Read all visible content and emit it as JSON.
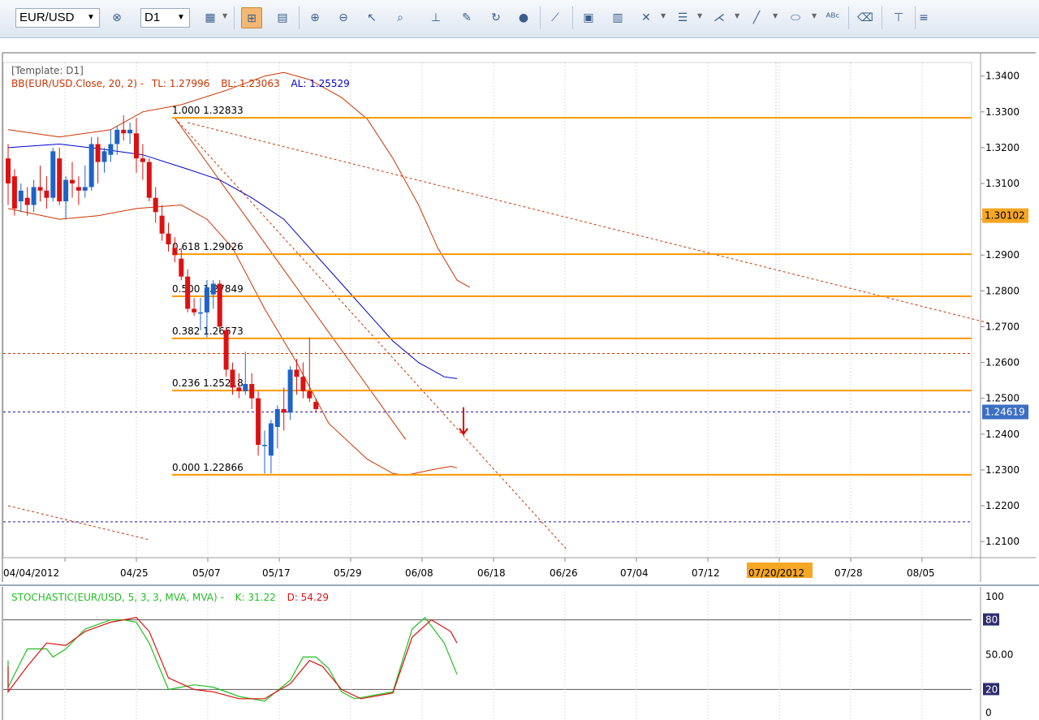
{
  "toolbar": {
    "symbol": "EUR/USD",
    "timeframe": "D1",
    "icons": [
      "chart-type-icon",
      "crosshair-icon",
      "template-icon",
      "zoom-in-icon",
      "zoom-out-icon",
      "cursor-icon",
      "magnifier-icon",
      "period-separator-icon",
      "template-icon",
      "refresh-icon",
      "globe-icon",
      "ruler-icon",
      "image-icon",
      "picture-icon",
      "tools-icon",
      "lines-icon",
      "fan-icon",
      "pencil-icon",
      "ellipse-icon",
      "text-icon",
      "eraser-icon",
      "hierarchy-icon",
      "menu-icon"
    ]
  },
  "chart_data": [
    {
      "type": "candlestick",
      "annotations": {
        "template": "[Template: D1]",
        "bb_label": "BB(EUR/USD.Close, 20, 2) -",
        "bb_tl": "TL: 1.27996",
        "bb_bl": "BL: 1.23063",
        "bb_al": "AL: 1.25529",
        "bb_color": "#cc3300",
        "al_color": "#0000cc"
      },
      "y_axis": {
        "ylim": [
          1.2055,
          1.3465
        ],
        "ticks": [
          "1.3400",
          "1.3300",
          "1.3200",
          "1.3100",
          "1.3000",
          "1.2900",
          "1.2800",
          "1.2700",
          "1.2600",
          "1.2500",
          "1.2400",
          "1.2300",
          "1.2200",
          "1.2100"
        ],
        "tick_values": [
          1.34,
          1.33,
          1.32,
          1.31,
          1.3,
          1.29,
          1.28,
          1.27,
          1.26,
          1.25,
          1.24,
          1.23,
          1.22,
          1.21
        ]
      },
      "x_axis": {
        "labels": [
          "04/04/2012",
          "04/25",
          "05/07",
          "05/17",
          "05/29",
          "06/08",
          "06/18",
          "06/26",
          "07/04",
          "07/12",
          "07/20/2012",
          "07/28",
          "08/05"
        ],
        "highlight_label": "07/20/2012",
        "highlight_color": "#f5a623"
      },
      "price_labels": [
        {
          "text": "1.30102",
          "value": 1.30102,
          "bg": "#f5a623"
        },
        {
          "text": "1.24619",
          "value": 1.24619,
          "bg": "#3c6fc4"
        }
      ],
      "fibonacci": [
        {
          "label": "1.000 1.32833",
          "value": 1.32833
        },
        {
          "label": "0.618 1.29026",
          "value": 1.29026
        },
        {
          "label": "0.500 1.27849",
          "value": 1.27849
        },
        {
          "label": "0.382 1.26673",
          "value": 1.26673
        },
        {
          "label": "0.236 1.25218",
          "value": 1.25218
        },
        {
          "label": "0.000 1.22866",
          "value": 1.22866
        }
      ],
      "horizontal_lines": [
        {
          "value": 1.2625,
          "color": "#cc3300",
          "style": "dashed"
        },
        {
          "value": 1.24619,
          "color": "#1a1aaa",
          "style": "dashed"
        },
        {
          "value": 1.2155,
          "color": "#1a1aaa",
          "style": "dashed"
        }
      ],
      "candles": [
        [
          1.317,
          1.321,
          1.304,
          1.31
        ],
        [
          1.312,
          1.314,
          1.301,
          1.303
        ],
        [
          1.305,
          1.31,
          1.302,
          1.308
        ],
        [
          1.306,
          1.309,
          1.301,
          1.304
        ],
        [
          1.304,
          1.311,
          1.302,
          1.309
        ],
        [
          1.309,
          1.315,
          1.305,
          1.308
        ],
        [
          1.308,
          1.312,
          1.303,
          1.306
        ],
        [
          1.306,
          1.32,
          1.305,
          1.319
        ],
        [
          1.317,
          1.32,
          1.304,
          1.305
        ],
        [
          1.305,
          1.312,
          1.3,
          1.311
        ],
        [
          1.311,
          1.316,
          1.306,
          1.31
        ],
        [
          1.309,
          1.312,
          1.304,
          1.308
        ],
        [
          1.308,
          1.315,
          1.306,
          1.309
        ],
        [
          1.309,
          1.323,
          1.308,
          1.321
        ],
        [
          1.321,
          1.323,
          1.31,
          1.316
        ],
        [
          1.316,
          1.32,
          1.313,
          1.319
        ],
        [
          1.318,
          1.325,
          1.316,
          1.321
        ],
        [
          1.321,
          1.326,
          1.318,
          1.325
        ],
        [
          1.325,
          1.329,
          1.322,
          1.324
        ],
        [
          1.324,
          1.327,
          1.321,
          1.325
        ],
        [
          1.324,
          1.3283,
          1.313,
          1.317
        ],
        [
          1.317,
          1.321,
          1.311,
          1.316
        ],
        [
          1.316,
          1.317,
          1.305,
          1.306
        ],
        [
          1.306,
          1.309,
          1.299,
          1.302
        ],
        [
          1.301,
          1.304,
          1.294,
          1.296
        ],
        [
          1.296,
          1.299,
          1.291,
          1.293
        ],
        [
          1.292,
          1.295,
          1.288,
          1.29
        ],
        [
          1.289,
          1.292,
          1.283,
          1.284
        ],
        [
          1.284,
          1.286,
          1.274,
          1.275
        ],
        [
          1.275,
          1.278,
          1.273,
          1.274
        ],
        [
          1.274,
          1.278,
          1.269,
          1.274
        ],
        [
          1.274,
          1.283,
          1.267,
          1.281
        ],
        [
          1.279,
          1.283,
          1.275,
          1.282
        ],
        [
          1.282,
          1.283,
          1.269,
          1.27
        ],
        [
          1.269,
          1.27,
          1.256,
          1.258
        ],
        [
          1.258,
          1.26,
          1.251,
          1.253
        ],
        [
          1.253,
          1.257,
          1.25,
          1.252
        ],
        [
          1.252,
          1.263,
          1.251,
          1.254
        ],
        [
          1.254,
          1.257,
          1.247,
          1.25
        ],
        [
          1.25,
          1.252,
          1.234,
          1.237
        ],
        [
          1.237,
          1.241,
          1.229,
          1.237
        ],
        [
          1.234,
          1.244,
          1.229,
          1.243
        ],
        [
          1.242,
          1.248,
          1.236,
          1.247
        ],
        [
          1.247,
          1.253,
          1.241,
          1.246
        ],
        [
          1.246,
          1.259,
          1.244,
          1.258
        ],
        [
          1.258,
          1.261,
          1.251,
          1.256
        ],
        [
          1.256,
          1.26,
          1.25,
          1.252
        ],
        [
          1.252,
          1.267,
          1.249,
          1.25
        ],
        [
          1.249,
          1.25,
          1.246,
          1.247
        ]
      ],
      "bollinger": {
        "upper": [
          [
            0,
            1.325
          ],
          [
            8,
            1.323
          ],
          [
            16,
            1.325
          ],
          [
            21,
            1.33
          ],
          [
            27,
            1.332
          ],
          [
            34,
            1.336
          ],
          [
            40,
            1.34
          ],
          [
            43,
            1.341
          ],
          [
            47,
            1.339
          ],
          [
            52,
            1.334
          ],
          [
            56,
            1.328
          ],
          [
            60,
            1.317
          ],
          [
            64,
            1.304
          ],
          [
            67,
            1.292
          ],
          [
            70,
            1.283
          ],
          [
            72,
            1.281
          ]
        ],
        "middle": [
          [
            0,
            1.32
          ],
          [
            8,
            1.321
          ],
          [
            15,
            1.3195
          ],
          [
            21,
            1.318
          ],
          [
            28,
            1.314
          ],
          [
            33,
            1.311
          ],
          [
            38,
            1.306
          ],
          [
            43,
            1.3
          ],
          [
            47,
            1.292
          ],
          [
            52,
            1.282
          ],
          [
            56,
            1.274
          ],
          [
            60,
            1.266
          ],
          [
            64,
            1.26
          ],
          [
            68,
            1.256
          ],
          [
            70,
            1.2555
          ]
        ],
        "lower": [
          [
            0,
            1.303
          ],
          [
            8,
            1.3
          ],
          [
            14,
            1.301
          ],
          [
            20,
            1.303
          ],
          [
            27,
            1.304
          ],
          [
            31,
            1.3
          ],
          [
            35,
            1.292
          ],
          [
            40,
            1.275
          ],
          [
            45,
            1.26
          ],
          [
            50,
            1.243
          ],
          [
            56,
            1.233
          ],
          [
            60,
            1.229
          ],
          [
            62,
            1.2285
          ],
          [
            66,
            1.23
          ],
          [
            69,
            1.231
          ],
          [
            70,
            1.2306
          ]
        ]
      },
      "trendlines": [
        {
          "points": [
            [
              26,
              1.3283
            ],
            [
              87,
              1.208
            ]
          ],
          "style": "dashed"
        },
        {
          "points": [
            [
              26,
              1.3283
            ],
            [
              62,
              1.2385
            ]
          ],
          "style": "solid"
        },
        {
          "points": [
            [
              28,
              1.327
            ],
            [
              153,
              1.271
            ]
          ],
          "style": "dashed"
        },
        {
          "points": [
            [
              0,
              1.22
            ],
            [
              22,
              1.2105
            ]
          ],
          "style": "dashed"
        }
      ],
      "arrow": {
        "index": 70,
        "from": 1.2475,
        "to": 1.24,
        "color": "#dd0000"
      }
    },
    {
      "type": "line",
      "label": {
        "name": "STOCHASTIC(EUR/USD, 5, 3, 3, MVA, MVA) -",
        "k": "K: 31.22",
        "d": "D: 54.29",
        "k_color": "#22c022",
        "d_color": "#dd1111"
      },
      "ylim": [
        0,
        100
      ],
      "ticks": [
        "100",
        "80",
        "50.00",
        "20",
        "0"
      ],
      "tick_values": [
        100,
        80,
        50,
        20,
        0
      ],
      "series": [
        {
          "color": "#22c022",
          "values": [
            [
              0,
              45
            ],
            [
              3,
              25
            ],
            [
              6,
              22
            ],
            [
              9,
              55
            ],
            [
              12,
              55
            ],
            [
              13,
              48
            ],
            [
              15,
              55
            ],
            [
              18,
              72
            ],
            [
              22,
              80
            ],
            [
              24,
              80
            ],
            [
              26,
              78
            ],
            [
              28,
              60
            ],
            [
              31,
              20
            ],
            [
              35,
              24
            ],
            [
              38,
              22
            ],
            [
              42,
              14
            ],
            [
              46,
              10
            ],
            [
              50,
              28
            ],
            [
              52,
              48
            ],
            [
              54,
              48
            ],
            [
              56,
              38
            ],
            [
              58,
              18
            ],
            [
              60,
              12
            ],
            [
              63,
              15
            ],
            [
              66,
              18
            ],
            [
              69,
              72
            ],
            [
              71,
              82
            ],
            [
              74,
              60
            ],
            [
              76,
              33
            ]
          ]
        },
        {
          "color": "#dd1111",
          "values": [
            [
              0,
              40
            ],
            [
              3,
              22
            ],
            [
              6,
              18
            ],
            [
              9,
              40
            ],
            [
              12,
              60
            ],
            [
              15,
              58
            ],
            [
              18,
              70
            ],
            [
              22,
              78
            ],
            [
              26,
              82
            ],
            [
              28,
              70
            ],
            [
              31,
              30
            ],
            [
              35,
              20
            ],
            [
              38,
              18
            ],
            [
              42,
              12
            ],
            [
              46,
              12
            ],
            [
              50,
              25
            ],
            [
              53,
              45
            ],
            [
              55,
              40
            ],
            [
              58,
              20
            ],
            [
              61,
              12
            ],
            [
              66,
              17
            ],
            [
              69,
              65
            ],
            [
              72,
              80
            ],
            [
              75,
              70
            ],
            [
              76,
              60
            ]
          ]
        }
      ]
    }
  ]
}
